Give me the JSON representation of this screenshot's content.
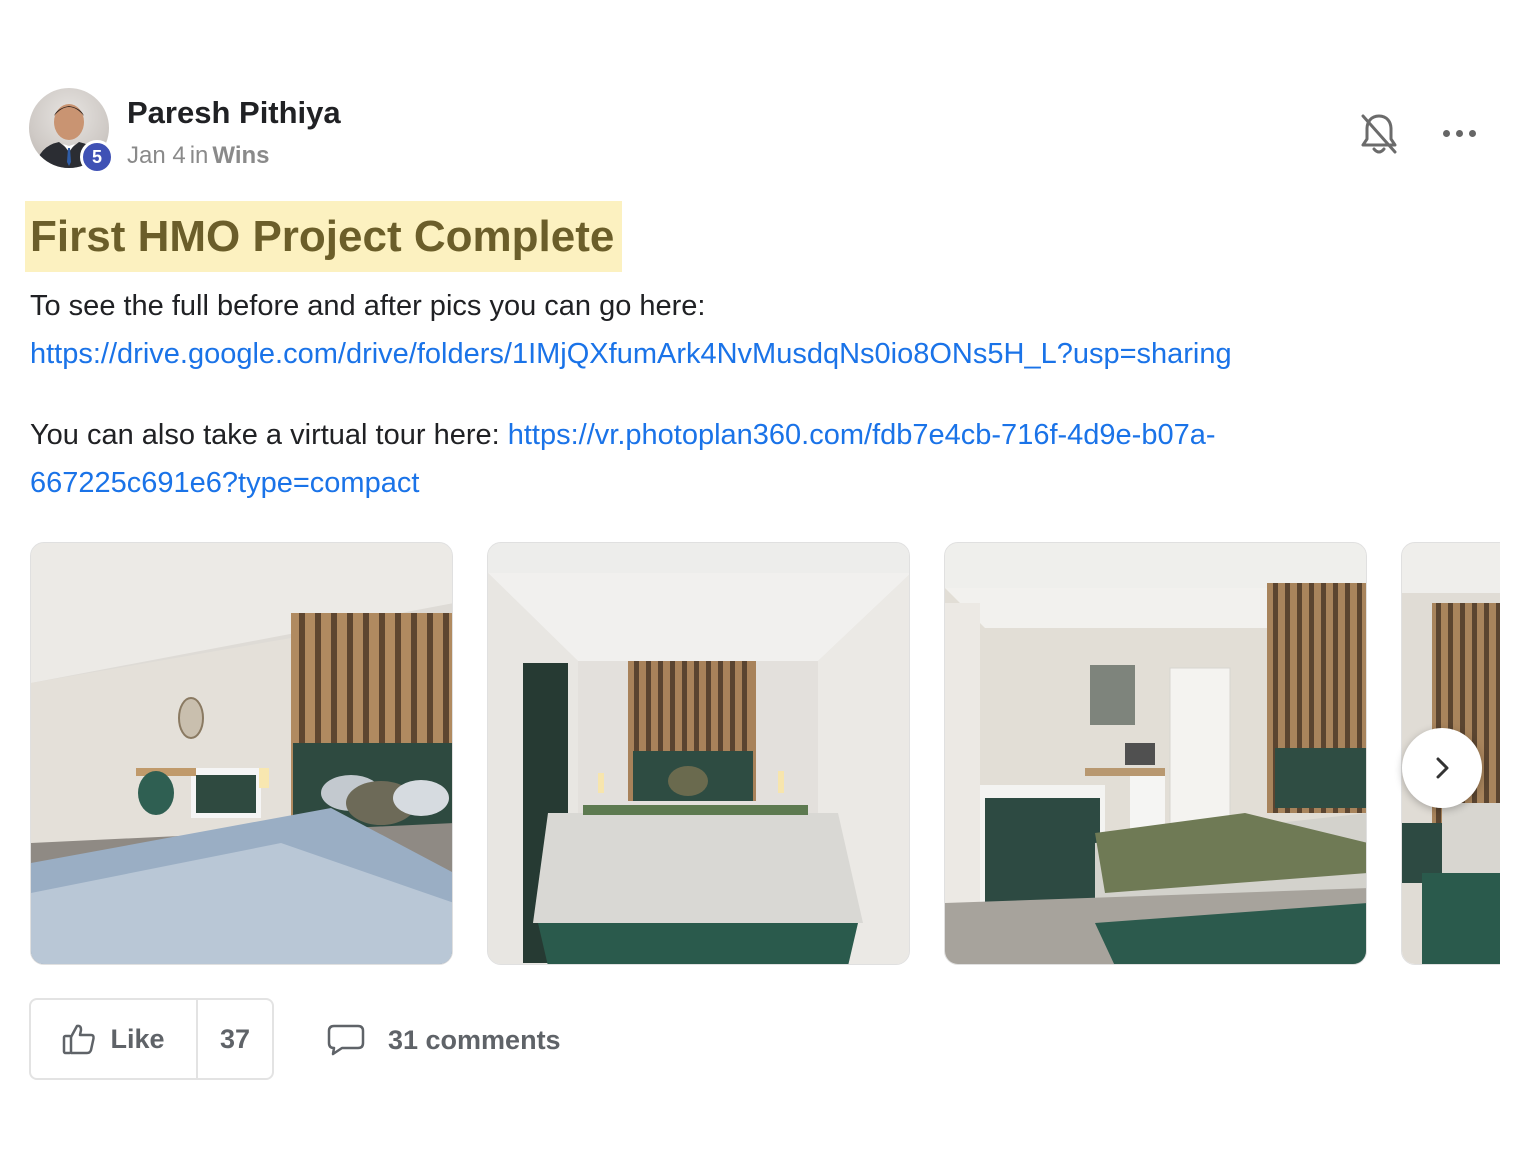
{
  "author": {
    "name": "Paresh Pithiya",
    "level": "5",
    "date": "Jan 4",
    "in_word": "in",
    "category": "Wins"
  },
  "icons": {
    "bell": "bell-off-icon",
    "more": "more-horizontal-icon",
    "next": "chevron-right-icon",
    "like": "thumbs-up-icon",
    "comment": "comment-icon"
  },
  "post": {
    "title": "First HMO Project Complete",
    "intro_text": "To see the full before and after pics you can go here:",
    "drive_link": "https://drive.google.com/drive/folders/1IMjQXfumArk4NvMusdqNs0io8ONs5H_L?usp=sharing",
    "tour_text": "You can also take a virtual tour here: ",
    "tour_link_line1": "https://vr.photoplan360.com/fdb7e4cb-716f-4d9e-b07a-",
    "tour_link_line2": "667225c691e6?type=compact"
  },
  "gallery": {
    "images": [
      "bedroom-photo-1",
      "bedroom-photo-2",
      "bedroom-photo-3",
      "bedroom-photo-4"
    ]
  },
  "footer": {
    "like_label": "Like",
    "like_count": "37",
    "comments_label": "31 comments"
  },
  "colors": {
    "link": "#1a73e8",
    "title_highlight": "#fcf1c0",
    "title_text": "#6b5e2a",
    "badge": "#3f51b5"
  }
}
